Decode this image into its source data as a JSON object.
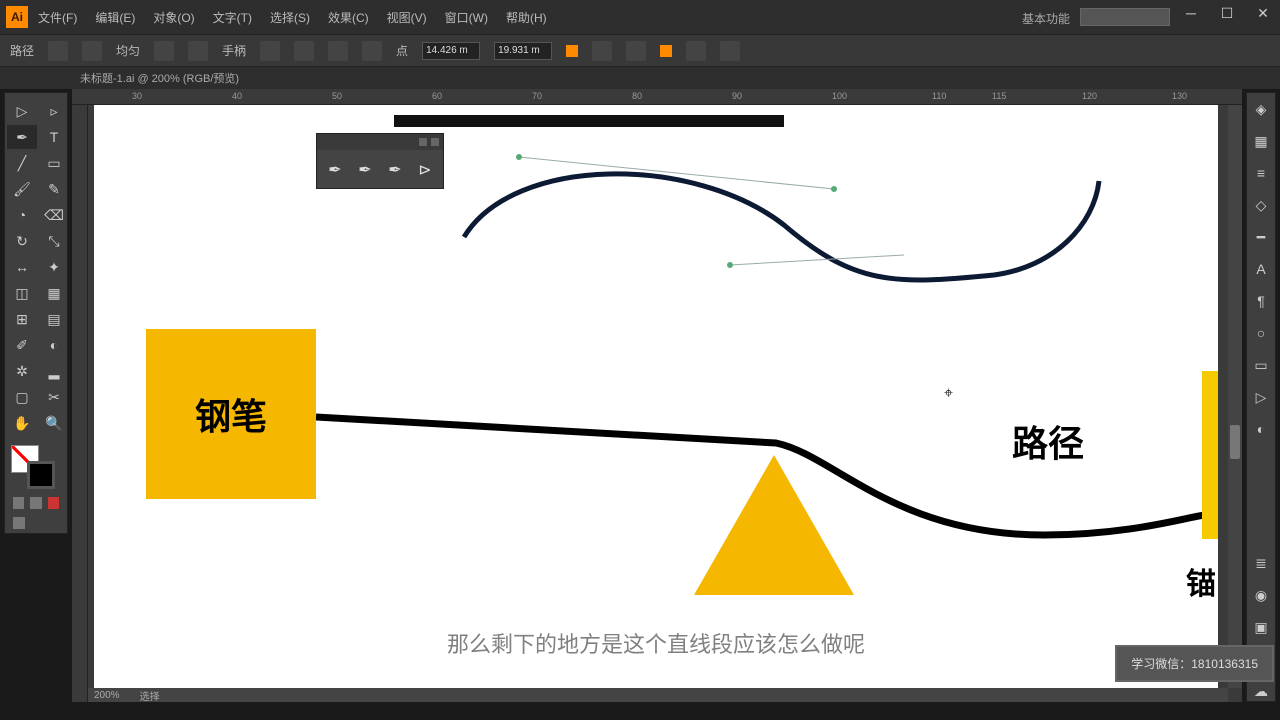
{
  "app": {
    "logo": "Ai"
  },
  "menu": [
    "文件(F)",
    "编辑(E)",
    "对象(O)",
    "文字(T)",
    "选择(S)",
    "效果(C)",
    "视图(V)",
    "窗口(W)",
    "帮助(H)"
  ],
  "preset_label": "基本功能",
  "doc_tab": "未标题-1.ai @ 200% (RGB/预览)",
  "control": {
    "label_left": "路径",
    "mode": "均匀",
    "hand_label": "手柄",
    "num1": "14.426 m",
    "num2": "19.931 m",
    "label_point": "点"
  },
  "ruler_ticks": [
    "30",
    "40",
    "50",
    "60",
    "70",
    "80",
    "90",
    "100",
    "110",
    "115",
    "120",
    "130"
  ],
  "artwork": {
    "box_label": "钢笔",
    "path_label": "路径",
    "anchor_label": "锚",
    "caption": "那么剩下的地方是这个直线段应该怎么做呢"
  },
  "contact": "学习微信：1810136315",
  "statusbar": {
    "zoom": "200%",
    "info": "选择"
  }
}
